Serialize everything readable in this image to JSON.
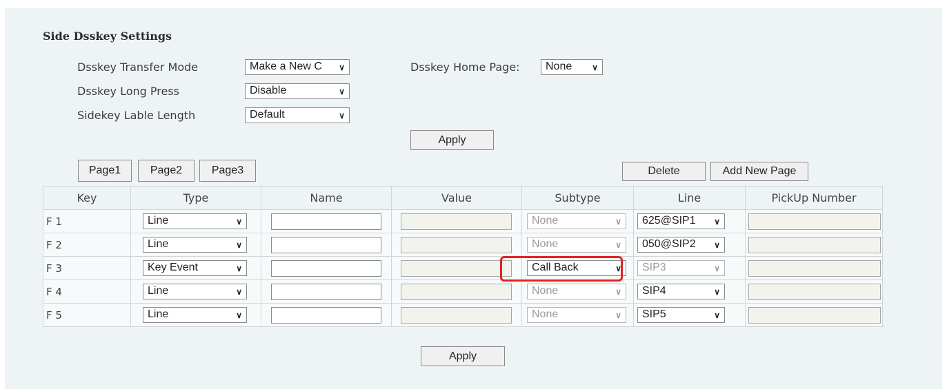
{
  "section_title": "Side Dsskey Settings",
  "settings": {
    "transfer_mode": {
      "label": "Dsskey Transfer Mode",
      "value": "Make a New C"
    },
    "long_press": {
      "label": "Dsskey Long Press",
      "value": "Disable"
    },
    "label_length": {
      "label": "Sidekey Lable Length",
      "value": "Default"
    },
    "home_page": {
      "label": "Dsskey Home Page:",
      "value": "None"
    }
  },
  "apply_label": "Apply",
  "pages": {
    "tabs": [
      "Page1",
      "Page2",
      "Page3"
    ],
    "delete_label": "Delete",
    "add_label": "Add New Page"
  },
  "table": {
    "columns": [
      "Key",
      "Type",
      "Name",
      "Value",
      "Subtype",
      "Line",
      "PickUp Number"
    ],
    "rows": [
      {
        "key": "F 1",
        "type": "Line",
        "name": "",
        "value": "",
        "subtype": "None",
        "line": "625@SIP1",
        "pickup": ""
      },
      {
        "key": "F 2",
        "type": "Line",
        "name": "",
        "value": "",
        "subtype": "None",
        "line": "050@SIP2",
        "pickup": ""
      },
      {
        "key": "F 3",
        "type": "Key Event",
        "name": "",
        "value": "",
        "subtype": "Call Back",
        "line": "SIP3",
        "pickup": ""
      },
      {
        "key": "F 4",
        "type": "Line",
        "name": "",
        "value": "",
        "subtype": "None",
        "line": "SIP4",
        "pickup": ""
      },
      {
        "key": "F 5",
        "type": "Line",
        "name": "",
        "value": "",
        "subtype": "None",
        "line": "SIP5",
        "pickup": ""
      }
    ]
  },
  "colors": {
    "highlight": "#e2221d",
    "panel_bg": "#eef4f6"
  },
  "icons": {
    "dropdown": "chevron-down-icon"
  }
}
